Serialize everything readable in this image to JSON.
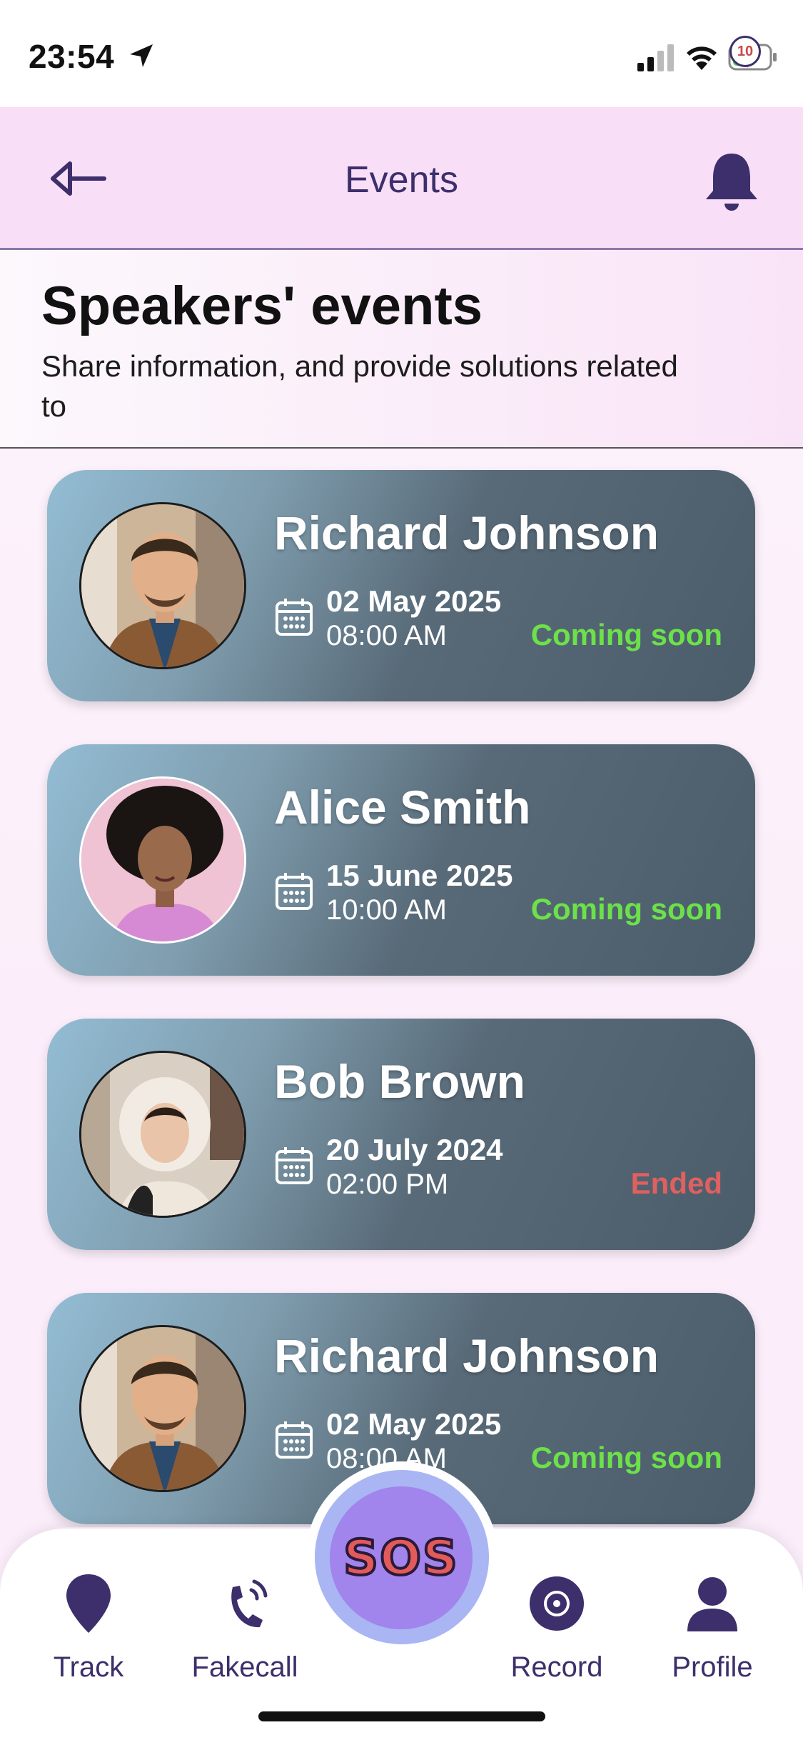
{
  "status_bar": {
    "time": "23:54"
  },
  "header": {
    "title": "Events",
    "notification_count": "10"
  },
  "intro": {
    "title": "Speakers' events",
    "subtitle": "Share information, and provide solutions related to"
  },
  "events": [
    {
      "name": "Richard Johnson",
      "date": "02 May 2025",
      "time": "08:00 AM",
      "status": "Coming soon",
      "status_color": "#6ce14a"
    },
    {
      "name": "Alice Smith",
      "date": "15 June 2025",
      "time": "10:00 AM",
      "status": "Coming soon",
      "status_color": "#6ce14a"
    },
    {
      "name": "Bob Brown",
      "date": "20 July 2024",
      "time": "02:00 PM",
      "status": "Ended",
      "status_color": "#e06060"
    },
    {
      "name": "Richard Johnson",
      "date": "02 May 2025",
      "time": "08:00 AM",
      "status": "Coming soon",
      "status_color": "#6ce14a"
    }
  ],
  "tabbar": {
    "track": "Track",
    "fakecall": "Fakecall",
    "sos": "SOS",
    "record": "Record",
    "profile": "Profile"
  },
  "colors": {
    "accent": "#3c2f6b",
    "header_bg": "#f8def6",
    "sos_button": "#a184ec",
    "sos_ring": "#a9b6f3"
  }
}
